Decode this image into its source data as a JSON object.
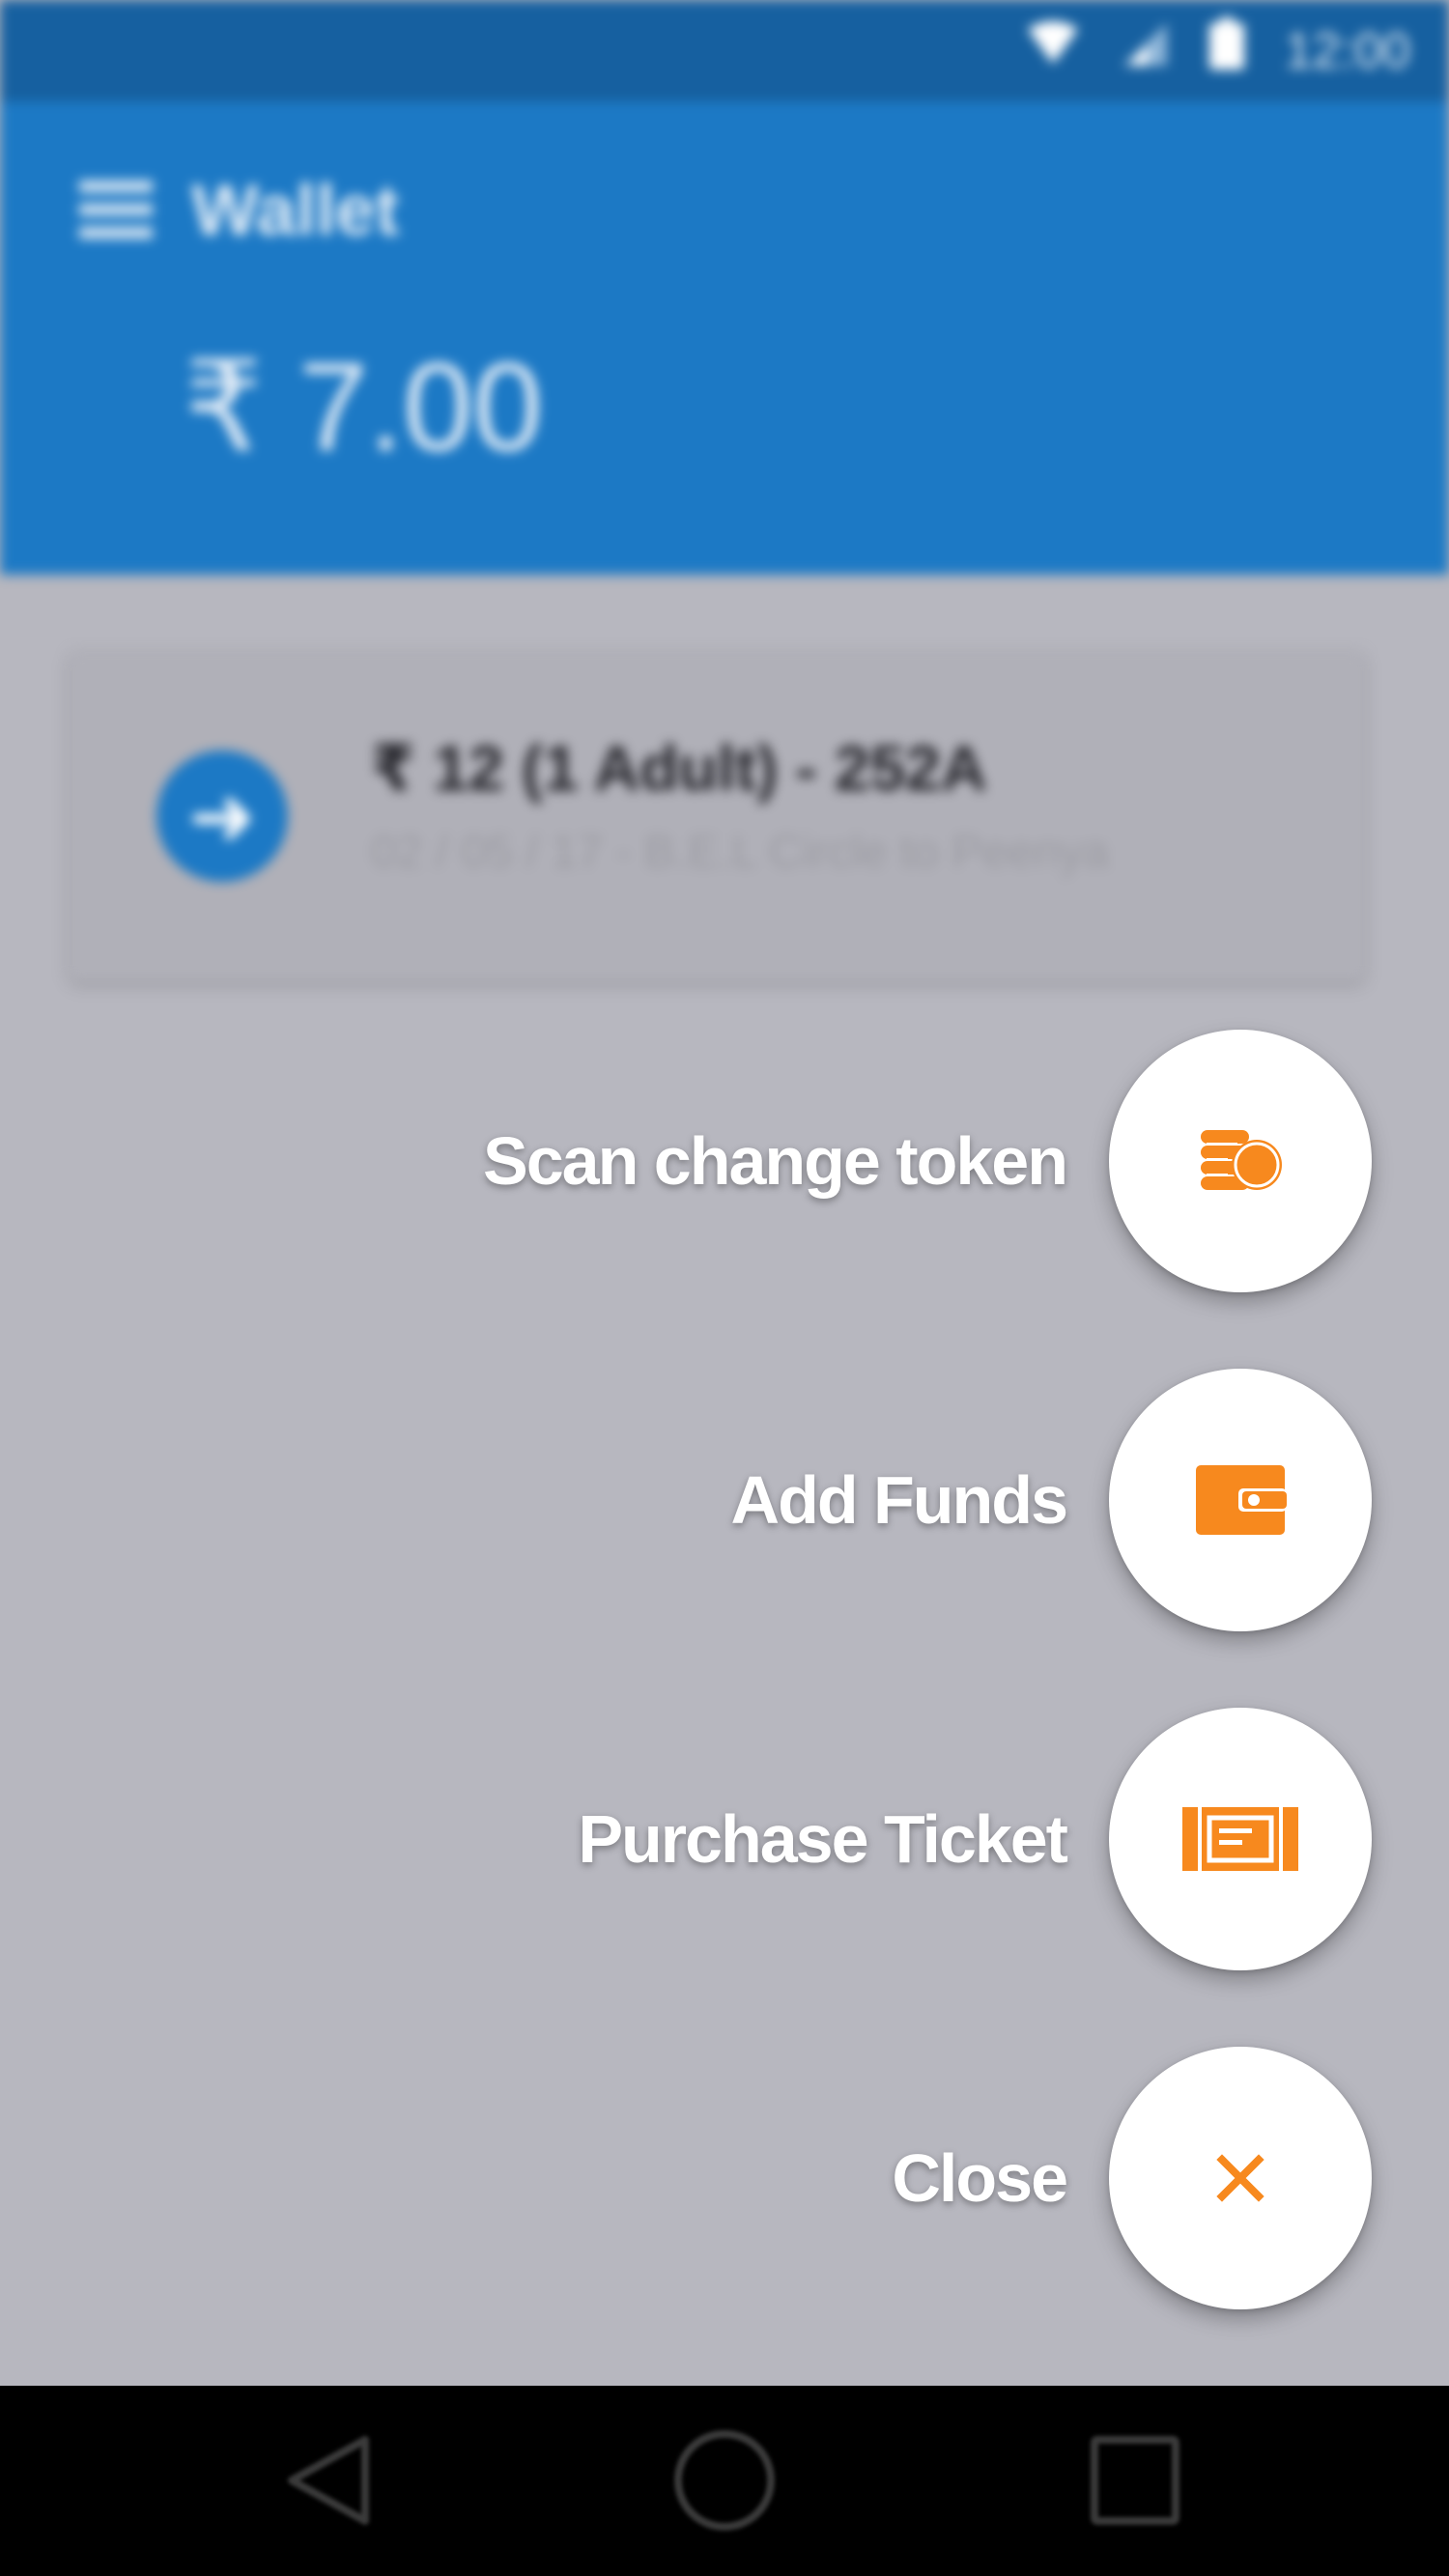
{
  "status_bar": {
    "time": "12:00",
    "icons": [
      "wifi-icon",
      "signal-icon",
      "battery-icon"
    ]
  },
  "app_bar": {
    "title": "Wallet",
    "balance": "₹ 7.00",
    "color": "#1c79c5"
  },
  "ticket": {
    "title": "₹ 12 (1 Adult) - 252A",
    "subtitle": "02 / 05 / 17 - B.E.L Circle to Peenya"
  },
  "speed_dial": {
    "accent": "#f7891e",
    "items": [
      {
        "label": "Scan change token",
        "icon": "coins-icon"
      },
      {
        "label": "Add Funds",
        "icon": "wallet-icon"
      },
      {
        "label": "Purchase Ticket",
        "icon": "ticket-icon"
      },
      {
        "label": "Close",
        "icon": "close-icon"
      }
    ]
  },
  "nav_bar": {
    "buttons": [
      "back-icon",
      "home-icon",
      "recents-icon"
    ]
  }
}
